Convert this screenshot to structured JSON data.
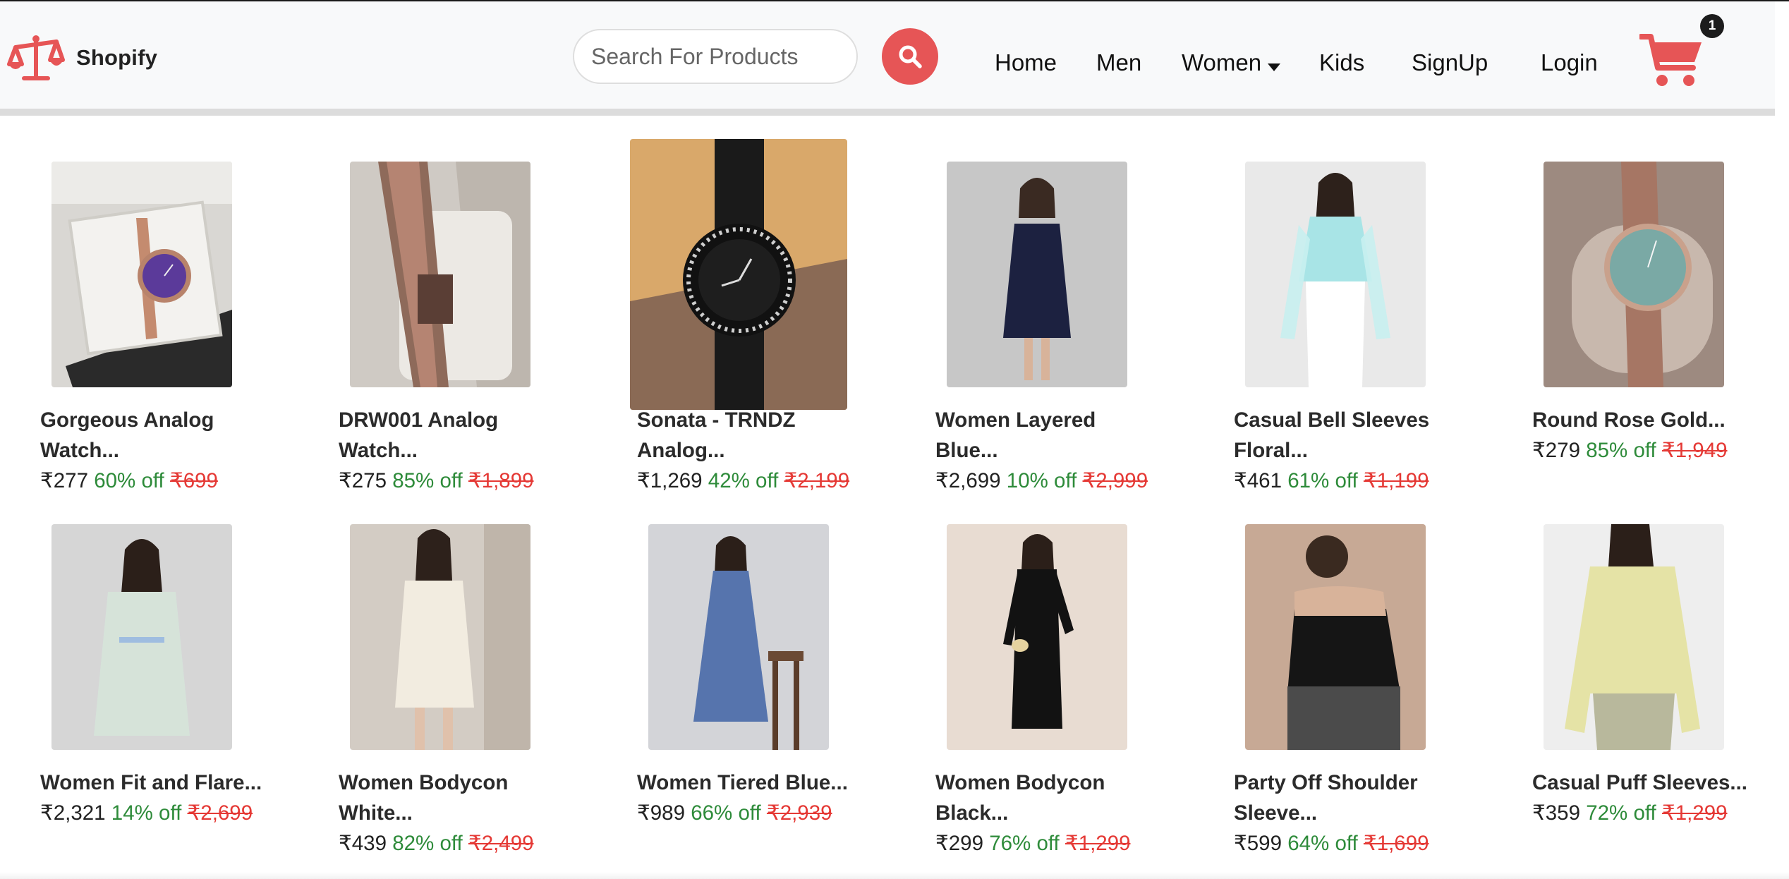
{
  "brand": {
    "name": "Shopify",
    "icon": "scales-icon",
    "color": "#e65556"
  },
  "search": {
    "placeholder": "Search For Products",
    "button_icon": "magnifier-icon"
  },
  "nav": {
    "home": "Home",
    "men": "Men",
    "women": "Women",
    "kids": "Kids",
    "signup": "SignUp",
    "login": "Login"
  },
  "cart": {
    "count": "1",
    "icon": "cart-icon",
    "color": "#e65556"
  },
  "colors": {
    "accent": "#e65556",
    "discount": "#2e8b3a",
    "original_price": "#e53935"
  },
  "products": [
    {
      "name_line1": "Gorgeous Analog",
      "name_line2": "Watch...",
      "price": "₹277",
      "discount": "60% off",
      "original": "₹699"
    },
    {
      "name_line1": "DRW001 Analog",
      "name_line2": "Watch...",
      "price": "₹275",
      "discount": "85% off",
      "original": "₹1,899"
    },
    {
      "name_line1": "Sonata - TRNDZ",
      "name_line2": "Analog...",
      "price": "₹1,269",
      "discount": "42% off",
      "original": "₹2,199"
    },
    {
      "name_line1": "Women Layered",
      "name_line2": "Blue...",
      "price": "₹2,699",
      "discount": "10% off",
      "original": "₹2,999"
    },
    {
      "name_line1": "Casual Bell Sleeves",
      "name_line2": "Floral...",
      "price": "₹461",
      "discount": "61% off",
      "original": "₹1,199"
    },
    {
      "name_line1": "Round Rose Gold...",
      "name_line2": "",
      "price": "₹279",
      "discount": "85% off",
      "original": "₹1,949"
    },
    {
      "name_line1": "Women Fit and Flare...",
      "name_line2": "",
      "price": "₹2,321",
      "discount": "14% off",
      "original": "₹2,699"
    },
    {
      "name_line1": "Women Bodycon",
      "name_line2": "White...",
      "price": "₹439",
      "discount": "82% off",
      "original": "₹2,499"
    },
    {
      "name_line1": "Women Tiered Blue...",
      "name_line2": "",
      "price": "₹989",
      "discount": "66% off",
      "original": "₹2,939"
    },
    {
      "name_line1": "Women Bodycon",
      "name_line2": "Black...",
      "price": "₹299",
      "discount": "76% off",
      "original": "₹1,299"
    },
    {
      "name_line1": "Party Off Shoulder",
      "name_line2": "Sleeve...",
      "price": "₹599",
      "discount": "64% off",
      "original": "₹1,699"
    },
    {
      "name_line1": "Casual Puff Sleeves...",
      "name_line2": "",
      "price": "₹359",
      "discount": "72% off",
      "original": "₹1,299"
    }
  ]
}
